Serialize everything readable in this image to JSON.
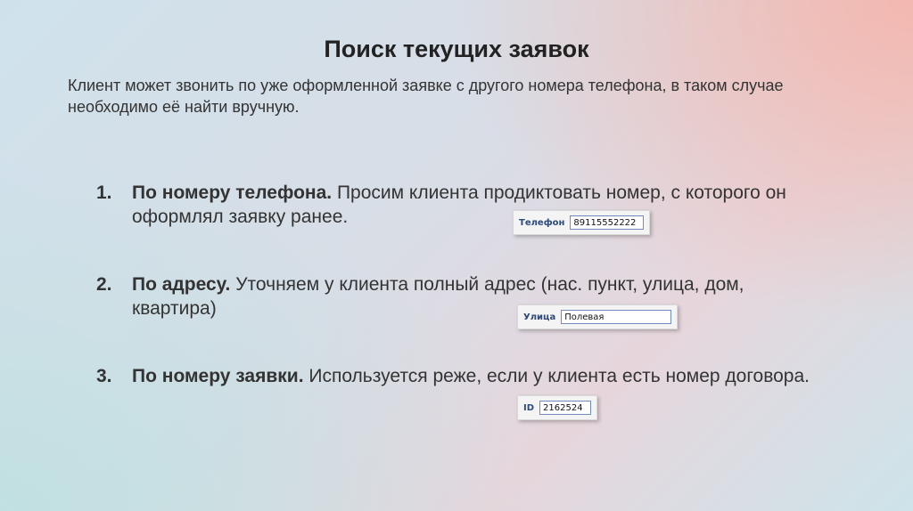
{
  "title": "Поиск текущих заявок",
  "intro": "Клиент может звонить по уже оформленной заявке с другого номера телефона, в таком случае необходимо её найти вручную.",
  "items": [
    {
      "number": "1.",
      "heading": "По номеру телефона.",
      "text": "Просим клиента продиктовать номер, с которого он оформлял заявку ранее.",
      "field_label": "Телефон",
      "field_value": "89115552222"
    },
    {
      "number": "2.",
      "heading": "По адресу.",
      "text": "Уточняем у клиента полный адрес (нас. пункт, улица, дом, квартира)",
      "field_label": "Улица",
      "field_value": "Полевая"
    },
    {
      "number": "3.",
      "heading": "По номеру заявки.",
      "text": "Используется реже, если у клиента есть номер договора.",
      "field_label": "ID",
      "field_value": "2162524"
    }
  ]
}
